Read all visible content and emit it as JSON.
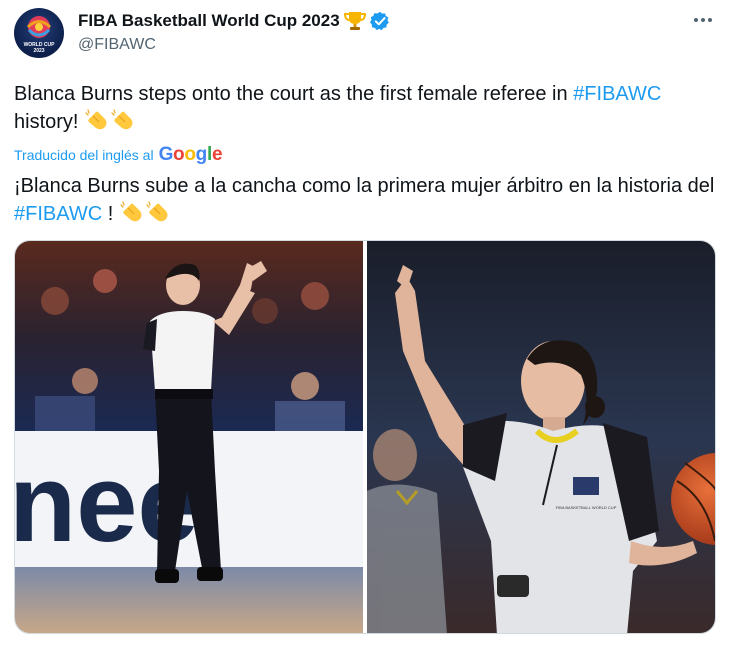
{
  "tweet": {
    "display_name": "FIBA Basketball World Cup 2023",
    "handle": "@FIBAWC",
    "verified_icon": "verified-badge-icon",
    "trophy_icon": "trophy-emoji",
    "avatar_text_1": "WORLD CUP",
    "avatar_text_2": "2023",
    "text_part1": "Blanca Burns steps onto the court as the first female referee in ",
    "hashtag": "#FIBAWC",
    "text_part2": " history! ",
    "translated_label": "Traducido del inglés al",
    "google_logo": "Google",
    "translated_part1": "¡Blanca Burns sube a la cancha como la primera mujer árbitro en la historia del ",
    "translated_hashtag": "#FIBAWC",
    "translated_part2": " ! ",
    "clap_emoji": "clapping-hands-emoji"
  },
  "media": {
    "photo1_banner_text": "nee",
    "photo2_jersey_text": "FIBA BASKETBALL WORLD CUP"
  },
  "colors": {
    "link": "#1d9bf0",
    "secondary_text": "#536471",
    "verified": "#1d9bf0"
  }
}
